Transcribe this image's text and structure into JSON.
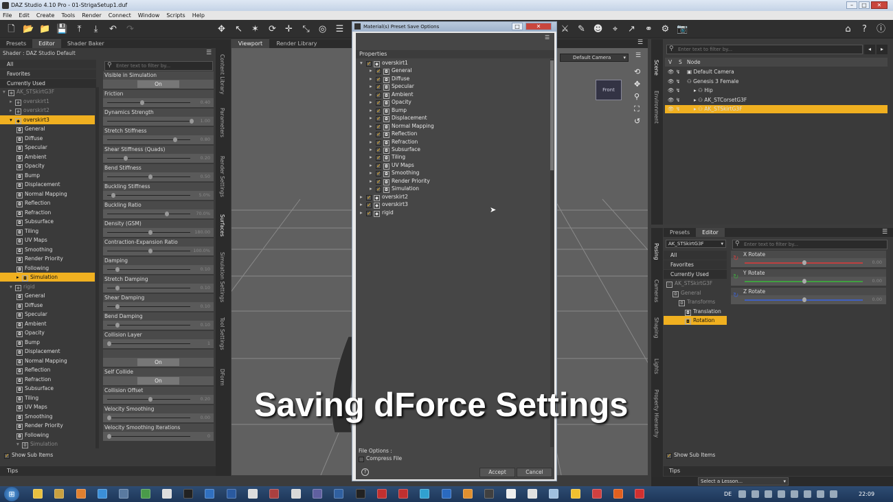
{
  "app": {
    "title": "DAZ Studio 4.10 Pro - 01-StrigaSetup1.duf",
    "min": "–",
    "max": "□",
    "close": "✕"
  },
  "menu": [
    "File",
    "Edit",
    "Create",
    "Tools",
    "Render",
    "Connect",
    "Window",
    "Scripts",
    "Help"
  ],
  "left": {
    "tabs": [
      "Presets",
      "Editor",
      "Shader Baker"
    ],
    "shader": "Shader : DAZ Studio Default",
    "filter": "Enter text to filter by...",
    "cats": [
      "All",
      "Favorites",
      "Currently Used"
    ],
    "tree": [
      {
        "t": "AK_STSkirtG3F",
        "lv": 0,
        "dim": true,
        "open": true
      },
      {
        "t": "overskirt1",
        "lv": 1,
        "dim": true,
        "arrow": "▸"
      },
      {
        "t": "overskirt2",
        "lv": 1,
        "dim": true,
        "arrow": "▸"
      },
      {
        "t": "overskirt3",
        "lv": 1,
        "sel": true,
        "arrow": "▾"
      },
      {
        "t": "General",
        "lv": 2
      },
      {
        "t": "Diffuse",
        "lv": 2
      },
      {
        "t": "Specular",
        "lv": 2
      },
      {
        "t": "Ambient",
        "lv": 2
      },
      {
        "t": "Opacity",
        "lv": 2
      },
      {
        "t": "Bump",
        "lv": 2
      },
      {
        "t": "Displacement",
        "lv": 2
      },
      {
        "t": "Normal Mapping",
        "lv": 2
      },
      {
        "t": "Reflection",
        "lv": 2
      },
      {
        "t": "Refraction",
        "lv": 2
      },
      {
        "t": "Subsurface",
        "lv": 2
      },
      {
        "t": "Tiling",
        "lv": 2
      },
      {
        "t": "UV Maps",
        "lv": 2
      },
      {
        "t": "Smoothing",
        "lv": 2
      },
      {
        "t": "Render Priority",
        "lv": 2
      },
      {
        "t": "Following",
        "lv": 2
      },
      {
        "t": "Simulation",
        "lv": 2,
        "sel": true,
        "arrow": "▸"
      },
      {
        "t": "rigid",
        "lv": 1,
        "dim": true,
        "arrow": "▾"
      },
      {
        "t": "General",
        "lv": 2
      },
      {
        "t": "Diffuse",
        "lv": 2
      },
      {
        "t": "Specular",
        "lv": 2
      },
      {
        "t": "Ambient",
        "lv": 2
      },
      {
        "t": "Opacity",
        "lv": 2
      },
      {
        "t": "Bump",
        "lv": 2
      },
      {
        "t": "Displacement",
        "lv": 2
      },
      {
        "t": "Normal Mapping",
        "lv": 2
      },
      {
        "t": "Reflection",
        "lv": 2
      },
      {
        "t": "Refraction",
        "lv": 2
      },
      {
        "t": "Subsurface",
        "lv": 2
      },
      {
        "t": "Tiling",
        "lv": 2
      },
      {
        "t": "UV Maps",
        "lv": 2
      },
      {
        "t": "Smoothing",
        "lv": 2
      },
      {
        "t": "Render Priority",
        "lv": 2
      },
      {
        "t": "Following",
        "lv": 2
      },
      {
        "t": "Simulation",
        "lv": 2,
        "dim": true,
        "arrow": "▾"
      }
    ],
    "show_sub": "Show Sub Items",
    "tips": "Tips",
    "props": [
      {
        "n": "Visible in Simulation",
        "on": "On"
      },
      {
        "n": "Friction",
        "v": "0.40",
        "p": 0.4
      },
      {
        "n": "Dynamics Strength",
        "v": "1.00",
        "p": 1.0
      },
      {
        "n": "Stretch Stiffness",
        "v": "0.80",
        "p": 0.8
      },
      {
        "n": "Shear Stiffness (Quads)",
        "v": "0.20",
        "p": 0.2
      },
      {
        "n": "Bend Stiffness",
        "v": "0.50",
        "p": 0.5
      },
      {
        "n": "Buckling Stiffness",
        "v": "5.0%",
        "p": 0.05
      },
      {
        "n": "Buckling Ratio",
        "v": "70.0%",
        "p": 0.7
      },
      {
        "n": "Density (GSM)",
        "v": "180.00",
        "p": 0.5
      },
      {
        "n": "Contraction-Expansion Ratio",
        "v": "100.0%",
        "p": 0.5
      },
      {
        "n": "Damping",
        "v": "0.10",
        "p": 0.1
      },
      {
        "n": "Stretch Damping",
        "v": "0.10",
        "p": 0.1
      },
      {
        "n": "Shear Damping",
        "v": "0.10",
        "p": 0.1
      },
      {
        "n": "Bend Damping",
        "v": "0.10",
        "p": 0.1
      },
      {
        "n": "Collision Layer",
        "v": "1",
        "p": 0.0
      },
      {
        "n": "",
        "on": "On"
      },
      {
        "n": "Self Collide",
        "on": "On"
      },
      {
        "n": "Collision Offset",
        "v": "0.20",
        "p": 0.5
      },
      {
        "n": "Velocity Smoothing",
        "v": "0.00",
        "p": 0.0
      },
      {
        "n": "Velocity Smoothing Iterations",
        "v": "0",
        "p": 0.0
      }
    ],
    "vtabs": [
      "Content Library",
      "Parameters",
      "Render Settings",
      "Surfaces",
      "Simulation Settings",
      "Tool Settings",
      "DForm"
    ]
  },
  "viewport": {
    "tabs": [
      "Viewport",
      "Render Library"
    ],
    "camera": "Default Camera",
    "cube": "Front"
  },
  "dialog": {
    "title": "Material(s) Preset Save Options",
    "section": "Properties",
    "items": [
      {
        "t": "overskirt1",
        "lv": 0,
        "open": true
      },
      {
        "t": "General",
        "lv": 1
      },
      {
        "t": "Diffuse",
        "lv": 1
      },
      {
        "t": "Specular",
        "lv": 1
      },
      {
        "t": "Ambient",
        "lv": 1
      },
      {
        "t": "Opacity",
        "lv": 1
      },
      {
        "t": "Bump",
        "lv": 1
      },
      {
        "t": "Displacement",
        "lv": 1
      },
      {
        "t": "Normal Mapping",
        "lv": 1
      },
      {
        "t": "Reflection",
        "lv": 1
      },
      {
        "t": "Refraction",
        "lv": 1
      },
      {
        "t": "Subsurface",
        "lv": 1
      },
      {
        "t": "Tiling",
        "lv": 1
      },
      {
        "t": "UV Maps",
        "lv": 1
      },
      {
        "t": "Smoothing",
        "lv": 1
      },
      {
        "t": "Render Priority",
        "lv": 1
      },
      {
        "t": "Simulation",
        "lv": 1
      },
      {
        "t": "overskirt2",
        "lv": 0
      },
      {
        "t": "overskirt3",
        "lv": 0
      },
      {
        "t": "rigid",
        "lv": 0
      }
    ],
    "file_options": "File Options :",
    "compress": "Compress File",
    "help": "?",
    "accept": "Accept",
    "cancel": "Cancel"
  },
  "scene": {
    "filter": "Enter text to filter by...",
    "cols": [
      "V",
      "S",
      "Node"
    ],
    "nodes": [
      {
        "t": "Default Camera",
        "lv": 1
      },
      {
        "t": "Genesis 3 Female",
        "lv": 1
      },
      {
        "t": "Hip",
        "lv": 2
      },
      {
        "t": "AK_STCorsetG3F",
        "lv": 2
      },
      {
        "t": "AK_STSkirtG3F",
        "lv": 2,
        "sel": true
      }
    ],
    "vtabs": [
      "Scene",
      "Environment"
    ]
  },
  "posing": {
    "tabs": [
      "Presets",
      "Editor"
    ],
    "select": "AK_STSkirtG3F",
    "filter": "Enter text to filter by...",
    "cats": [
      "All",
      "Favorites",
      "Currently Used"
    ],
    "tree": [
      {
        "t": "AK_STSkirtG3F",
        "lv": 0,
        "dim": true
      },
      {
        "t": "General",
        "lv": 1,
        "dim": true
      },
      {
        "t": "Transforms",
        "lv": 2,
        "dim": true
      },
      {
        "t": "Translation",
        "lv": 3
      },
      {
        "t": "Rotation",
        "lv": 3,
        "sel": true
      }
    ],
    "props": [
      {
        "n": "X Rotate",
        "v": "0.00",
        "c": "#c04040"
      },
      {
        "n": "Y Rotate",
        "v": "0.00",
        "c": "#40a040"
      },
      {
        "n": "Z Rotate",
        "v": "0.00",
        "c": "#4060c0"
      }
    ],
    "show_sub": "Show Sub Items",
    "tips": "Tips",
    "lesson": "Select a Lesson...",
    "vtabs": [
      "Posing",
      "Cameras",
      "Shaping",
      "Lights",
      "Property Hierarchy"
    ]
  },
  "caption": "Saving dForce Settings",
  "taskbar": {
    "lang": "DE",
    "time": "22:09"
  }
}
